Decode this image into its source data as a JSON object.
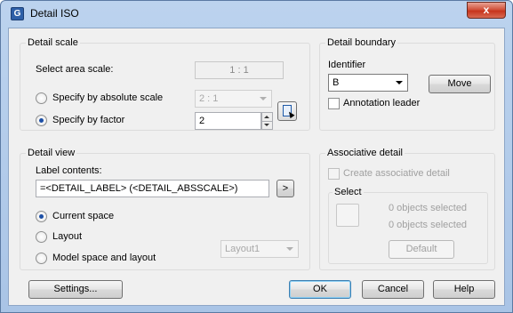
{
  "window": {
    "title": "Detail ISO",
    "app_icon": "G",
    "close_icon": "x"
  },
  "detail_scale": {
    "title": "Detail scale",
    "select_area_scale_label": "Select area scale:",
    "select_area_scale_value": "1 : 1",
    "absolute_scale_label": "Specify by absolute scale",
    "absolute_scale_value": "2 : 1",
    "factor_label": "Specify by factor",
    "factor_value": "2",
    "selected_option": "factor"
  },
  "detail_boundary": {
    "title": "Detail boundary",
    "identifier_label": "Identifier",
    "identifier_value": "B",
    "move_label": "Move",
    "annotation_leader_label": "Annotation leader"
  },
  "detail_view": {
    "title": "Detail view",
    "label_contents_label": "Label contents:",
    "label_contents_value": "=<DETAIL_LABEL> (<DETAIL_ABSSCALE>)",
    "insert_field_label": ">",
    "current_space_label": "Current space",
    "layout_label": "Layout",
    "model_space_label": "Model space and layout",
    "layout_combo_value": "Layout1",
    "selected_option": "current_space"
  },
  "associative_detail": {
    "title": "Associative detail",
    "create_label": "Create associative detail",
    "select_title": "Select",
    "selected_count_1": "0 objects selected",
    "selected_count_2": "0 objects selected",
    "default_label": "Default"
  },
  "footer": {
    "settings_label": "Settings...",
    "ok_label": "OK",
    "cancel_label": "Cancel",
    "help_label": "Help"
  }
}
